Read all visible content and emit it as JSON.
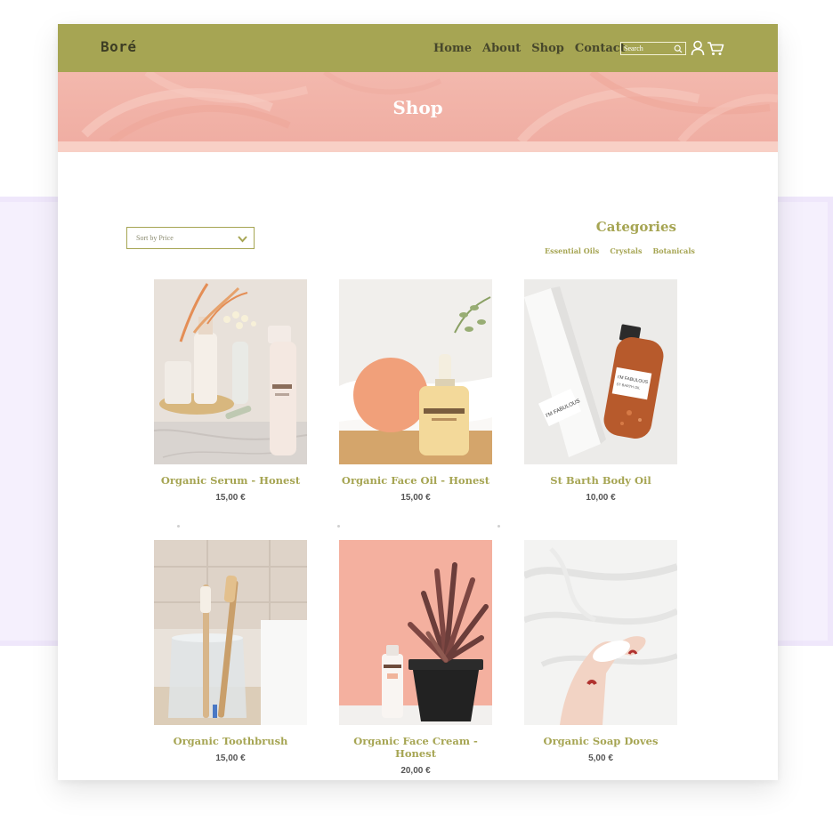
{
  "brand": {
    "logo": "Boré"
  },
  "nav": {
    "links": [
      "Home",
      "About",
      "Shop",
      "Contact"
    ],
    "search_placeholder": "Search"
  },
  "hero": {
    "title": "Shop"
  },
  "filters": {
    "sort_label": "Sort by Price",
    "categories_title": "Categories",
    "categories": [
      "Essential Oils",
      "Crystals",
      "Botanicals"
    ]
  },
  "products": [
    {
      "name": "Organic Serum - Honest",
      "price": "15,00 €"
    },
    {
      "name": "Organic Face Oil - Honest",
      "price": "15,00 €"
    },
    {
      "name": "St Barth Body Oil",
      "price": "10,00 €"
    },
    {
      "name": "Organic Toothbrush",
      "price": "15,00 €"
    },
    {
      "name": "Organic Face Cream - Honest",
      "price": "20,00 €"
    },
    {
      "name": "Organic Soap Doves",
      "price": "5,00 €"
    }
  ],
  "colors": {
    "accent": "#a6a553",
    "hero": "#f0aea3",
    "highlight": "#f5f0fd"
  }
}
